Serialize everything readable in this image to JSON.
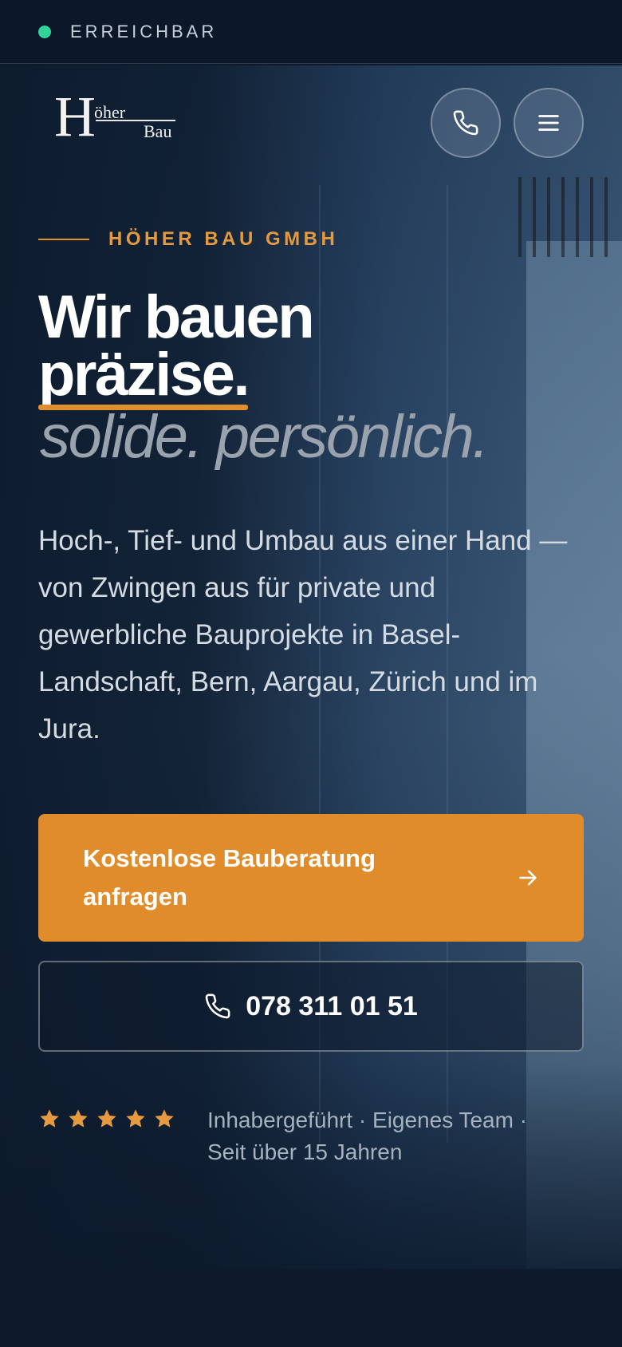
{
  "status": {
    "indicator_color": "#34d399",
    "label": "ERREICHBAR"
  },
  "header": {
    "logo": {
      "letter": "H",
      "word1": "öher",
      "word2": "Bau"
    },
    "phone_button_icon": "phone-icon",
    "menu_button_icon": "menu-icon"
  },
  "hero": {
    "kicker": "HÖHER BAU GMBH",
    "headline_line1": "Wir bauen",
    "headline_line2": "präzise.",
    "headline_sub": "solide. persönlich.",
    "lead": "Hoch-, Tief- und Umbau aus einer Hand — von Zwingen aus für private und gewerbliche Bauprojekte in Basel-Landschaft, Bern, Aargau, Zürich und im Jura.",
    "cta_label": "Kostenlose Bauberatung anfragen",
    "cta_icon": "arrow-right-icon",
    "phone_number": "078 311 01 51",
    "phone_icon": "phone-icon",
    "rating_stars": 5,
    "rating_text": "Inhabergeführt · Eigenes Team · Seit über 15 Jahren"
  },
  "colors": {
    "accent": "#e08c2b",
    "background": "#0c1a2c",
    "status_green": "#34d399"
  }
}
